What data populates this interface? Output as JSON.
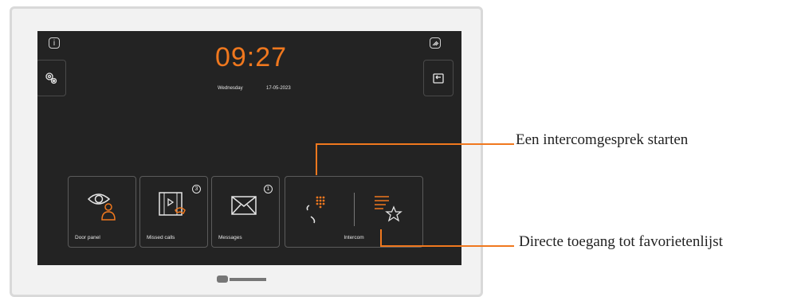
{
  "screen": {
    "clock": {
      "time": "09:27",
      "day": "Wednesday",
      "date": "17-05-2023"
    },
    "tiles": [
      {
        "label": "Door panel"
      },
      {
        "label": "Missed calls",
        "badge": "3"
      },
      {
        "label": "Messages",
        "badge": "1"
      },
      {
        "label": "Intercom"
      }
    ],
    "icons": {
      "top_left": "info-icon",
      "settings": "settings-gear-icon",
      "top_right": "wifi-signal-icon",
      "back": "back-arrow-icon"
    },
    "accent_color": "#f0781e"
  },
  "callouts": {
    "intercom_start": "Een intercomgesprek starten",
    "favorites": "Directe toegang tot favorietenlijst"
  }
}
